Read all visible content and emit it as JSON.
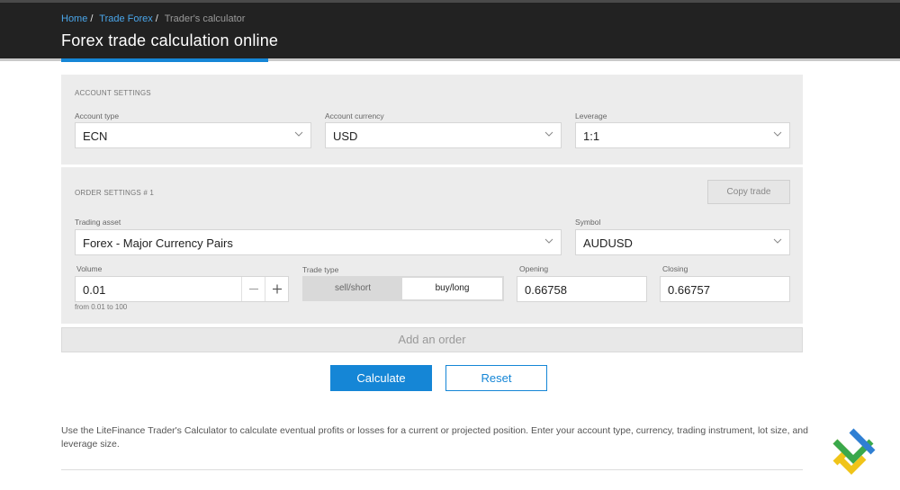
{
  "breadcrumb": {
    "items": [
      "Home",
      "Trade Forex"
    ],
    "current": "Trader's calculator",
    "separator": "/"
  },
  "page_title": "Forex trade calculation online",
  "account_settings": {
    "section_label": "ACCOUNT SETTINGS",
    "account_type": {
      "label": "Account type",
      "value": "ECN"
    },
    "account_currency": {
      "label": "Account currency",
      "value": "USD"
    },
    "leverage": {
      "label": "Leverage",
      "value": "1:1"
    }
  },
  "order_settings": {
    "section_label": "ORDER SETTINGS # 1",
    "copy_trade_label": "Copy trade",
    "trading_asset": {
      "label": "Trading asset",
      "value": "Forex - Major Currency Pairs"
    },
    "symbol": {
      "label": "Symbol",
      "value": "AUDUSD"
    },
    "volume": {
      "label": "Volume",
      "value": "0.01",
      "hint": "from 0.01 to 100",
      "minus": "−",
      "plus": "+"
    },
    "trade_type": {
      "label": "Trade type",
      "options": [
        "sell/short",
        "buy/long"
      ],
      "selected": "buy/long"
    },
    "opening": {
      "label": "Opening",
      "value": "0.66758"
    },
    "closing": {
      "label": "Closing",
      "value": "0.66757"
    }
  },
  "add_order_label": "Add an order",
  "buttons": {
    "calculate": "Calculate",
    "reset": "Reset"
  },
  "description": "Use the LiteFinance Trader's Calculator to calculate eventual profits or losses for a current or projected position. Enter your account type, currency, trading instrument, lot size, and leverage size.",
  "colors": {
    "header_bg": "#222222",
    "accent": "#1586d6",
    "panel_bg": "#ececec",
    "logo_green": "#3aa84b",
    "logo_yellow": "#f0c419",
    "logo_blue": "#2f7fd3"
  },
  "icons": {
    "select_caret": "chevron-down-icon",
    "logo": "litefinance-logo-icon"
  }
}
